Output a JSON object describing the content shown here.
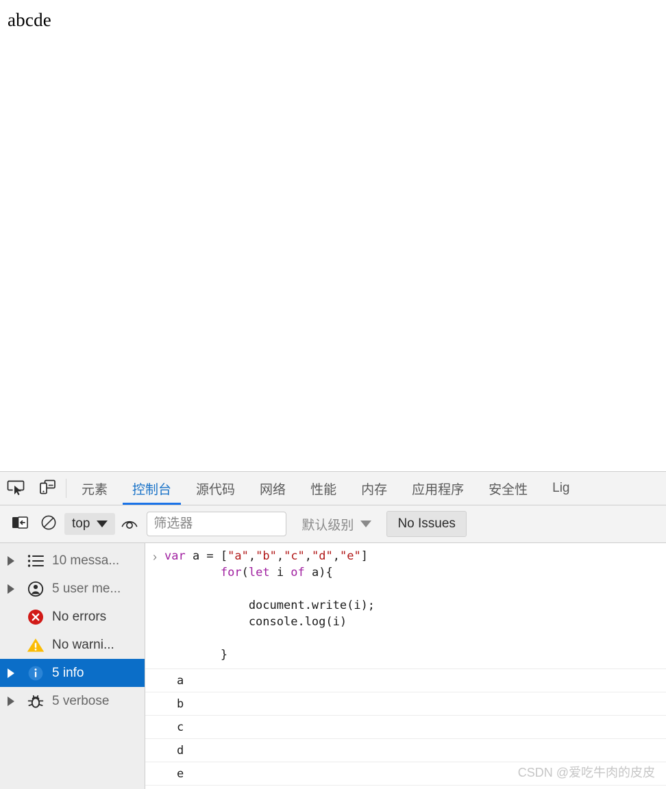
{
  "page": {
    "body_text": "abcde"
  },
  "devtools": {
    "toolbar_icons": {
      "inspect": "inspect-element-icon",
      "device": "device-toolbar-icon"
    },
    "tabs": [
      {
        "label": "元素",
        "active": false
      },
      {
        "label": "控制台",
        "active": true
      },
      {
        "label": "源代码",
        "active": false
      },
      {
        "label": "网络",
        "active": false
      },
      {
        "label": "性能",
        "active": false
      },
      {
        "label": "内存",
        "active": false
      },
      {
        "label": "应用程序",
        "active": false
      },
      {
        "label": "安全性",
        "active": false
      },
      {
        "label": "Lig",
        "active": false
      }
    ],
    "console_toolbar": {
      "sidebar_toggle_icon": "sidebar-toggle-icon",
      "clear_console_icon": "clear-console-icon",
      "context_label": "top",
      "eye_icon": "live-expression-eye-icon",
      "filter_value": "",
      "filter_placeholder": "筛选器",
      "level_label": "默认级别",
      "issues_label": "No Issues"
    },
    "sidebar": {
      "items": [
        {
          "label": "10 messa...",
          "icon": "list-icon",
          "arrow": true,
          "selected": false,
          "strong": false
        },
        {
          "label": "5 user me...",
          "icon": "user-message-icon",
          "arrow": true,
          "selected": false,
          "strong": false
        },
        {
          "label": "No errors",
          "icon": "error-icon",
          "arrow": false,
          "selected": false,
          "strong": true
        },
        {
          "label": "No warni...",
          "icon": "warning-icon",
          "arrow": false,
          "selected": false,
          "strong": true
        },
        {
          "label": "5 info",
          "icon": "info-icon",
          "arrow": true,
          "selected": true,
          "strong": false
        },
        {
          "label": "5 verbose",
          "icon": "bug-icon",
          "arrow": true,
          "selected": false,
          "strong": false
        }
      ]
    },
    "console": {
      "prompt_chevron": "›",
      "command_lines": [
        [
          {
            "t": "var",
            "c": "kw"
          },
          {
            "t": " a = [",
            "c": ""
          },
          {
            "t": "\"a\"",
            "c": "str"
          },
          {
            "t": ",",
            "c": ""
          },
          {
            "t": "\"b\"",
            "c": "str"
          },
          {
            "t": ",",
            "c": ""
          },
          {
            "t": "\"c\"",
            "c": "str"
          },
          {
            "t": ",",
            "c": ""
          },
          {
            "t": "\"d\"",
            "c": "str"
          },
          {
            "t": ",",
            "c": ""
          },
          {
            "t": "\"e\"",
            "c": "str"
          },
          {
            "t": "]",
            "c": ""
          }
        ],
        [
          {
            "t": "        ",
            "c": ""
          },
          {
            "t": "for",
            "c": "kw"
          },
          {
            "t": "(",
            "c": ""
          },
          {
            "t": "let",
            "c": "kw"
          },
          {
            "t": " i ",
            "c": ""
          },
          {
            "t": "of",
            "c": "kw"
          },
          {
            "t": " a){",
            "c": ""
          }
        ],
        [
          {
            "t": "",
            "c": ""
          }
        ],
        [
          {
            "t": "            document.write(i);",
            "c": ""
          }
        ],
        [
          {
            "t": "            console.log(i)",
            "c": ""
          }
        ],
        [
          {
            "t": "",
            "c": ""
          }
        ],
        [
          {
            "t": "        }",
            "c": ""
          }
        ]
      ],
      "output_rows": [
        "a",
        "b",
        "c",
        "d",
        "e"
      ]
    },
    "watermark": "CSDN @爱吃牛肉的皮皮",
    "colors": {
      "accent_blue": "#1a73e8",
      "selection_blue": "#0b6ec8",
      "error_red": "#d93025",
      "warning_yellow": "#fbbc04",
      "panel_bg": "#f3f3f3",
      "sidebar_bg": "#eeeeee"
    }
  }
}
